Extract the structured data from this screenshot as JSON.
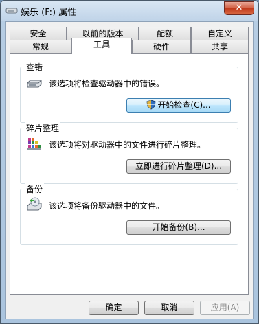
{
  "window": {
    "title": "娱乐 (F:) 属性",
    "close_label": "✕"
  },
  "tabs": {
    "back_row": [
      "安全",
      "以前的版本",
      "配额",
      "自定义"
    ],
    "front_row": [
      "常规",
      "工具",
      "硬件",
      "共享"
    ],
    "active": "工具"
  },
  "groups": {
    "error_check": {
      "title": "查错",
      "description": "该选项将检查驱动器中的错误。",
      "button": "开始检查(C)..."
    },
    "defrag": {
      "title": "碎片整理",
      "description": "该选项将对驱动器中的文件进行碎片整理。",
      "button": "立即进行碎片整理(D)..."
    },
    "backup": {
      "title": "备份",
      "description": "该选项将备份驱动器中的文件。",
      "button": "开始备份(B)..."
    }
  },
  "footer": {
    "ok": "确定",
    "cancel": "取消",
    "apply": "应用(A)"
  },
  "icons": {
    "title": "drive-icon",
    "error_check": "hard-drive-icon",
    "defrag": "defragment-icon",
    "backup": "backup-icon",
    "uac": "uac-shield-icon"
  }
}
